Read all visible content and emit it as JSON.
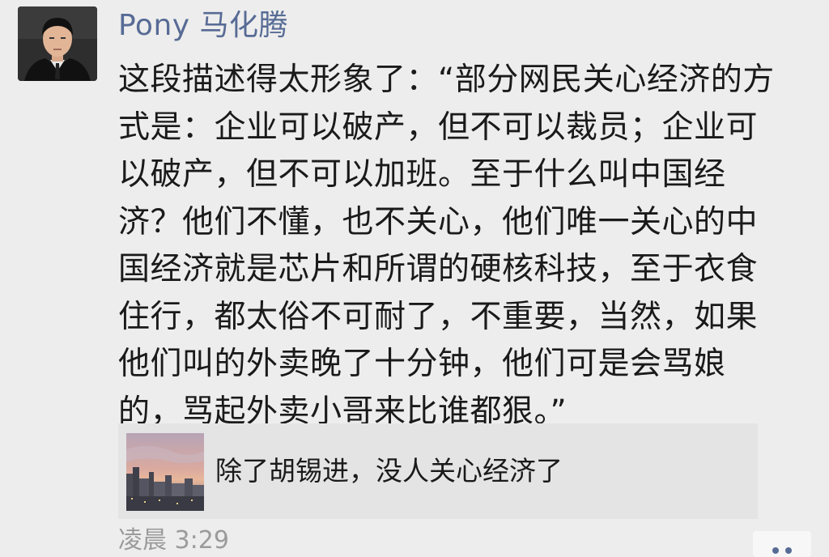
{
  "post": {
    "author": "Pony 马化腾",
    "avatar_icon": "user-avatar-photo",
    "text_lines": [
      "这段描述得太形象了：“部分网民关心经济的方",
      "式是：企业可以破产，但不可以裁员；企业可",
      "以破产，但不可以加班。至于什么叫中国经",
      "济？他们不懂，也不关心，他们唯一关心的中",
      "国经济就是芯片和所谓的硬核科技，至于衣食",
      "住行，都太俗不可耐了，不重要，当然，如果",
      "他们叫的外卖晚了十分钟，他们可是会骂娘",
      "的，骂起外卖小哥来比谁都狠。”"
    ],
    "shared_link": {
      "title": "除了胡锡进，没人关心经济了",
      "thumbnail_icon": "city-skyline-thumbnail"
    },
    "timestamp": "凌晨 3:29",
    "more_icon": "more-dots-icon",
    "link_color": "#576b95"
  }
}
